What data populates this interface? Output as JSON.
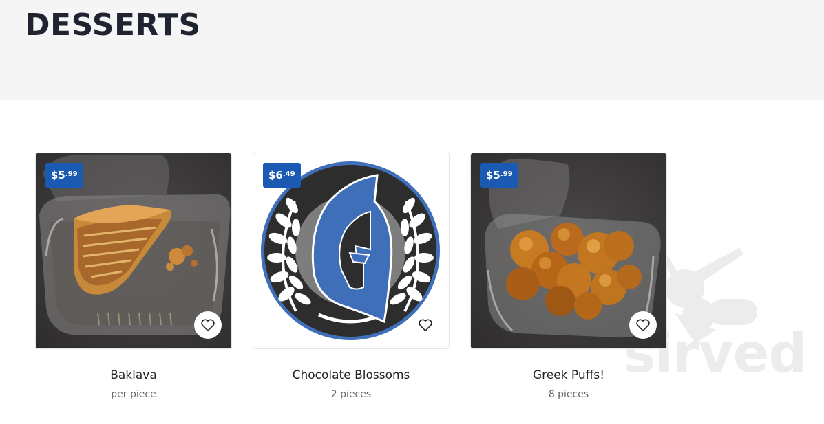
{
  "section": {
    "title": "DESSERTS"
  },
  "items": [
    {
      "name": "Baklava",
      "description": "per piece",
      "price_main": "$5",
      "price_cents": ".99",
      "image": "baklava-photo"
    },
    {
      "name": "Chocolate Blossoms",
      "description": "2 pieces",
      "price_main": "$6",
      "price_cents": ".49",
      "image": "spartan-helmet-logo"
    },
    {
      "name": "Greek Puffs!",
      "description": "8 pieces",
      "price_main": "$5",
      "price_cents": ".99",
      "image": "greek-puffs-photo"
    }
  ],
  "watermark": {
    "text": "sirved"
  },
  "colors": {
    "price_badge": "#1b5ab3",
    "header_bg": "#f5f5f5",
    "logo_blue": "#3e6fb8"
  }
}
